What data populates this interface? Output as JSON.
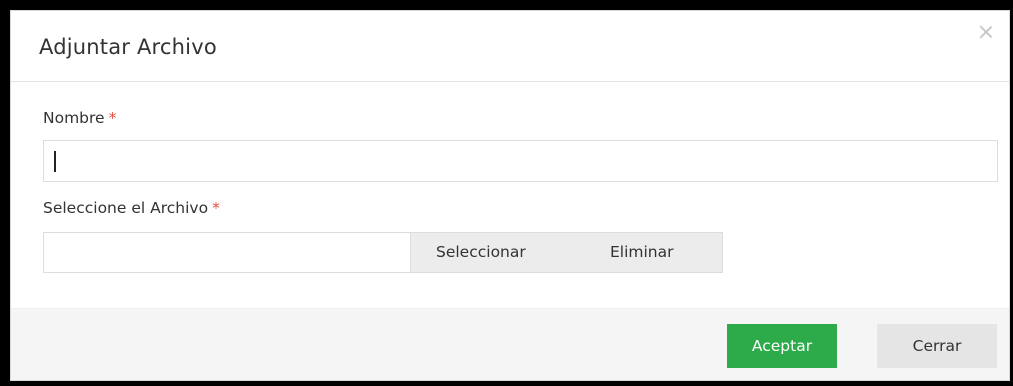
{
  "dialog": {
    "title": "Adjuntar Archivo",
    "close_icon": "close-icon"
  },
  "form": {
    "name_label": "Nombre",
    "name_required": "*",
    "name_value": "",
    "file_label": "Seleccione el Archivo",
    "file_required": "*",
    "file_value": "",
    "select_label": "Seleccionar",
    "delete_label": "Eliminar"
  },
  "footer": {
    "accept_label": "Aceptar",
    "close_label": "Cerrar"
  },
  "colors": {
    "accept": "#2daa4a",
    "required": "#e74c3c"
  }
}
